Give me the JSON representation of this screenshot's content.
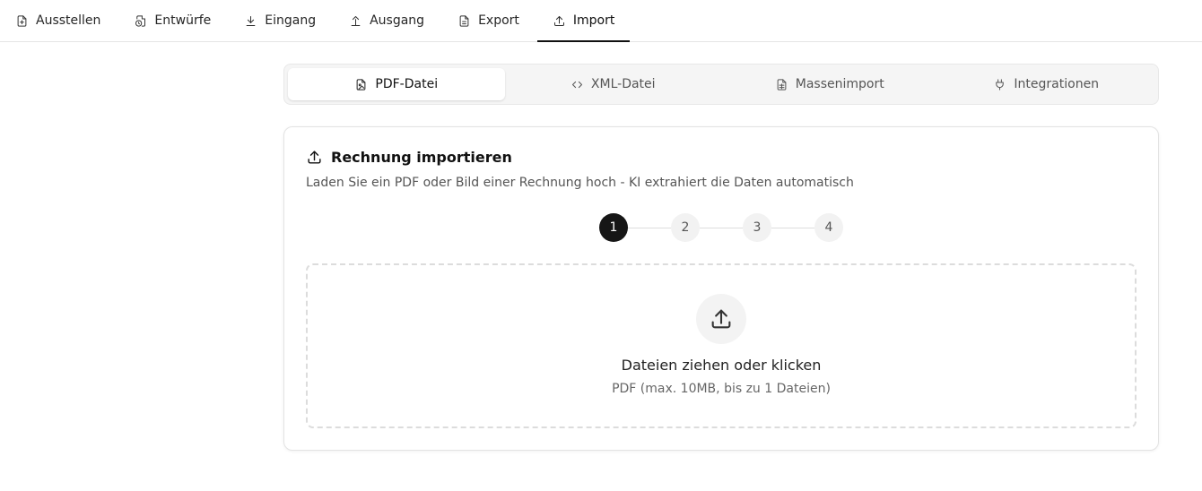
{
  "topnav": {
    "items": [
      {
        "label": "Ausstellen",
        "icon": "file-plus-icon"
      },
      {
        "label": "Entwürfe",
        "icon": "file-clock-icon"
      },
      {
        "label": "Eingang",
        "icon": "download-icon"
      },
      {
        "label": "Ausgang",
        "icon": "upload-icon"
      },
      {
        "label": "Export",
        "icon": "file-text-icon"
      },
      {
        "label": "Import",
        "icon": "upload-icon",
        "active": true
      }
    ]
  },
  "tabs": {
    "items": [
      {
        "label": "PDF-Datei",
        "icon": "file-image-icon",
        "active": true
      },
      {
        "label": "XML-Datei",
        "icon": "code-icon"
      },
      {
        "label": "Massenimport",
        "icon": "file-spreadsheet-icon"
      },
      {
        "label": "Integrationen",
        "icon": "plug-icon"
      }
    ]
  },
  "card": {
    "title": "Rechnung importieren",
    "subtitle": "Laden Sie ein PDF oder Bild einer Rechnung hoch - KI extrahiert die Daten automatisch"
  },
  "stepper": {
    "steps": [
      "1",
      "2",
      "3",
      "4"
    ],
    "current": 1
  },
  "dropzone": {
    "title": "Dateien ziehen oder klicken",
    "hint": "PDF (max. 10MB, bis zu 1 Dateien)"
  },
  "colors": {
    "accent": "#111111",
    "muted": "#f5f5f5",
    "border": "#e5e5e5"
  }
}
